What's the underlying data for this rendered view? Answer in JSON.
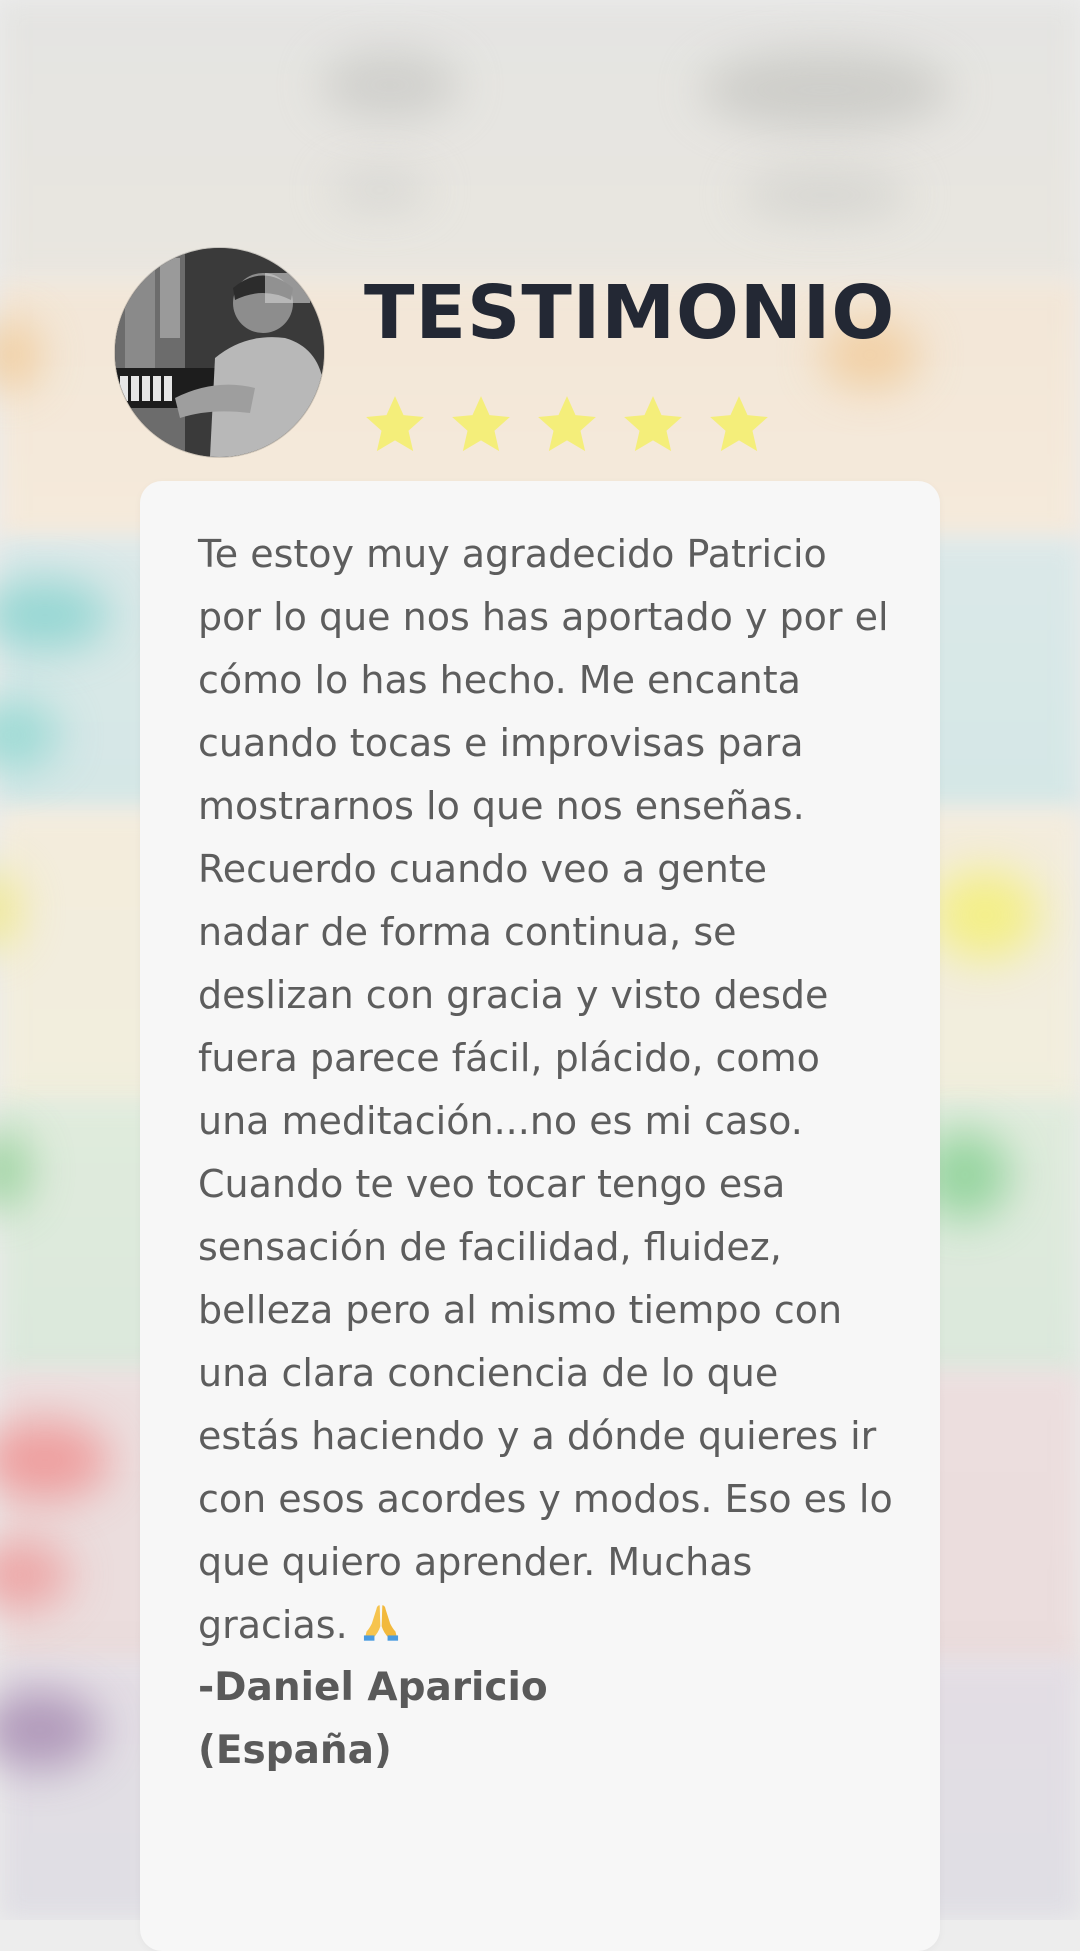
{
  "header": {
    "title": "TESTIMONIO",
    "rating": {
      "stars": 5,
      "max": 5,
      "star_color": "#f4ee7a"
    },
    "avatar": {
      "subject": "man playing piano",
      "style": "grayscale"
    }
  },
  "testimonial": {
    "quote_lines": [
      "Te estoy muy agradecido Patricio",
      "por lo que nos has aportado y por el",
      "cómo lo has hecho. Me encanta",
      "cuando tocas e improvisas para",
      "mostrarnos lo que nos enseñas.",
      "Recuerdo cuando veo a gente",
      "nadar de forma continua, se",
      "deslizan con gracia y visto desde",
      "fuera parece fácil, plácido, como",
      "una meditación...no es mi caso.",
      "Cuando te veo tocar tengo esa",
      "sensación de facilidad, fluidez,",
      "belleza pero al mismo tiempo con",
      "una clara conciencia de lo que",
      "estás haciendo y a dónde quieres ir",
      "con esos acordes y modos. Eso es lo",
      "que quiero aprender. Muchas",
      "gracias."
    ],
    "emoji": "praying-hands-icon",
    "author": "-Daniel Aparicio",
    "country": "(España)"
  },
  "colors": {
    "title": "#232834",
    "text": "#5d5d5d",
    "card": "#f7f7f7"
  }
}
